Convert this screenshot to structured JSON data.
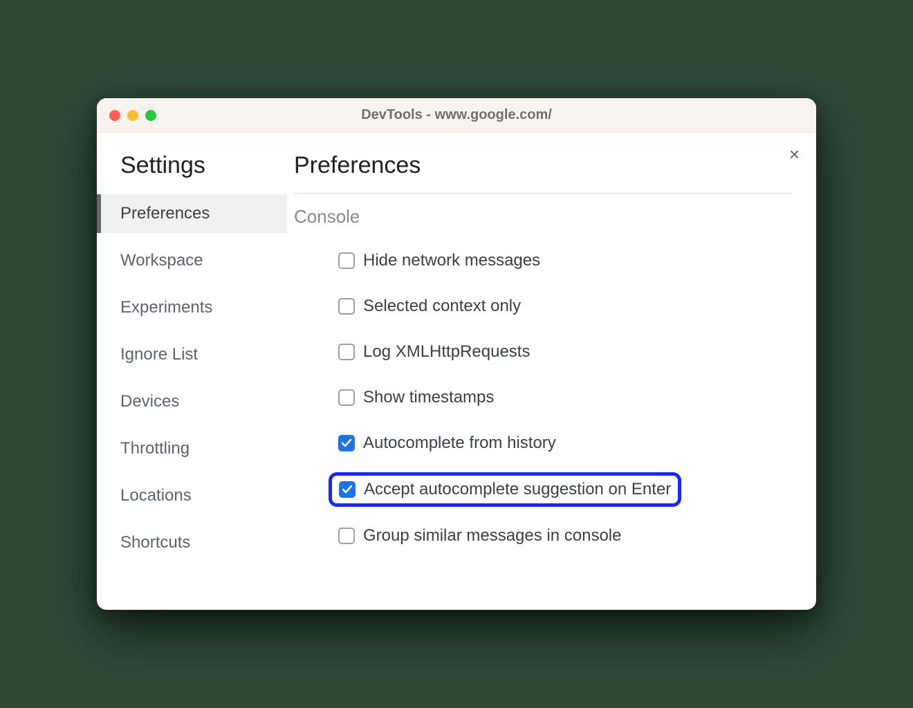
{
  "window": {
    "title": "DevTools - www.google.com/"
  },
  "sidebar": {
    "heading": "Settings",
    "items": [
      {
        "label": "Preferences",
        "active": true
      },
      {
        "label": "Workspace",
        "active": false
      },
      {
        "label": "Experiments",
        "active": false
      },
      {
        "label": "Ignore List",
        "active": false
      },
      {
        "label": "Devices",
        "active": false
      },
      {
        "label": "Throttling",
        "active": false
      },
      {
        "label": "Locations",
        "active": false
      },
      {
        "label": "Shortcuts",
        "active": false
      }
    ]
  },
  "content": {
    "heading": "Preferences",
    "section": "Console",
    "options": [
      {
        "label": "Hide network messages",
        "checked": false,
        "highlight": false
      },
      {
        "label": "Selected context only",
        "checked": false,
        "highlight": false
      },
      {
        "label": "Log XMLHttpRequests",
        "checked": false,
        "highlight": false
      },
      {
        "label": "Show timestamps",
        "checked": false,
        "highlight": false
      },
      {
        "label": "Autocomplete from history",
        "checked": true,
        "highlight": false
      },
      {
        "label": "Accept autocomplete suggestion on Enter",
        "checked": true,
        "highlight": true
      },
      {
        "label": "Group similar messages in console",
        "checked": false,
        "highlight": false
      }
    ]
  }
}
